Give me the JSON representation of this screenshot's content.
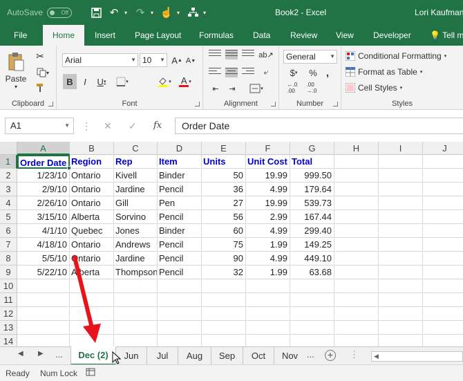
{
  "titlebar": {
    "autosave_label": "AutoSave",
    "autosave_state": "Off",
    "document_title": "Book2  -  Excel",
    "user_name": "Lori Kaufman"
  },
  "ribbon_tabs": [
    "File",
    "Home",
    "Insert",
    "Page Layout",
    "Formulas",
    "Data",
    "Review",
    "View",
    "Developer",
    "Tell m"
  ],
  "active_ribbon_tab": "Home",
  "ribbon": {
    "clipboard": {
      "label": "Clipboard",
      "paste_label": "Paste"
    },
    "font": {
      "label": "Font",
      "font_name": "Arial",
      "font_size": "10",
      "bold": "B",
      "italic": "I",
      "underline": "U",
      "grow": "A",
      "shrink": "A",
      "font_color_letter": "A"
    },
    "alignment": {
      "label": "Alignment"
    },
    "number": {
      "label": "Number",
      "format": "General",
      "currency": "$",
      "percent": "%",
      "comma": ","
    },
    "styles": {
      "label": "Styles",
      "conditional_formatting": "Conditional Formatting",
      "format_as_table": "Format as Table",
      "cell_styles": "Cell Styles"
    }
  },
  "formula_bar": {
    "name_box": "A1",
    "fx": "fx",
    "content": "Order Date"
  },
  "grid": {
    "columns": [
      "A",
      "B",
      "C",
      "D",
      "E",
      "F",
      "G",
      "H",
      "I",
      "J"
    ],
    "row_numbers": [
      "1",
      "2",
      "3",
      "4",
      "5",
      "6",
      "7",
      "8",
      "9",
      "10",
      "11",
      "12",
      "13",
      "14"
    ],
    "header": [
      "Order Date",
      "Region",
      "Rep",
      "Item",
      "Units",
      "Unit Cost",
      "Total"
    ],
    "rows": [
      [
        "1/23/10",
        "Ontario",
        "Kivell",
        "Binder",
        "50",
        "19.99",
        "999.50"
      ],
      [
        "2/9/10",
        "Ontario",
        "Jardine",
        "Pencil",
        "36",
        "4.99",
        "179.64"
      ],
      [
        "2/26/10",
        "Ontario",
        "Gill",
        "Pen",
        "27",
        "19.99",
        "539.73"
      ],
      [
        "3/15/10",
        "Alberta",
        "Sorvino",
        "Pencil",
        "56",
        "2.99",
        "167.44"
      ],
      [
        "4/1/10",
        "Quebec",
        "Jones",
        "Binder",
        "60",
        "4.99",
        "299.40"
      ],
      [
        "4/18/10",
        "Ontario",
        "Andrews",
        "Pencil",
        "75",
        "1.99",
        "149.25"
      ],
      [
        "5/5/10",
        "Ontario",
        "Jardine",
        "Pencil",
        "90",
        "4.99",
        "449.10"
      ],
      [
        "5/22/10",
        "Alberta",
        "Thompson",
        "Pencil",
        "32",
        "1.99",
        "63.68"
      ]
    ]
  },
  "sheet_tabs": {
    "leading_ellipsis": "...",
    "trailing_ellipsis": "...",
    "tabs": [
      "Dec (2)",
      "Jun",
      "Jul",
      "Aug",
      "Sep",
      "Oct",
      "Nov"
    ],
    "active": "Dec (2)"
  },
  "statusbar": {
    "ready": "Ready",
    "num_lock": "Num Lock"
  },
  "colors": {
    "excel_green": "#217346",
    "header_text_blue": "#0000cc",
    "annotation_arrow": "#e8141b"
  }
}
